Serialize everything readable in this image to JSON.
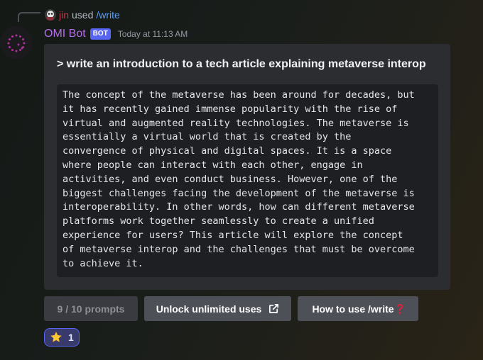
{
  "command_usage": {
    "user": "jin",
    "used_text": "used",
    "command": "/write"
  },
  "message": {
    "author": "OMI Bot",
    "badge": "BOT",
    "timestamp": "Today at 11:13 AM",
    "accent_color": "#b36ee6"
  },
  "embed": {
    "title": "> write an introduction to a tech article explaining metaverse interop",
    "body": "The concept of the metaverse has been around for decades, but\nit has recently gained immense popularity with the rise of\nvirtual and augmented reality technologies. The metaverse is\nessentially a virtual world that is created by the\nconvergence of physical and digital spaces. It is a space\nwhere people can interact with each other, engage in\nactivities, and even conduct business. However, one of the\nbiggest challenges facing the development of the metaverse is\ninteroperability. In other words, how can different metaverse\nplatforms work together seamlessly to create a unified\nexperience for users? This article will explore the concept\nof metaverse interop and the challenges that must be overcome\nto achieve it."
  },
  "buttons": {
    "prompts_label": "9 / 10 prompts",
    "unlock_label": "Unlock unlimited uses",
    "unlock_icon": "external-link-icon",
    "howto_label": "How to use /write",
    "howto_icon": "red-question-mark-icon"
  },
  "reaction": {
    "emoji": "star-icon",
    "count": "1"
  }
}
